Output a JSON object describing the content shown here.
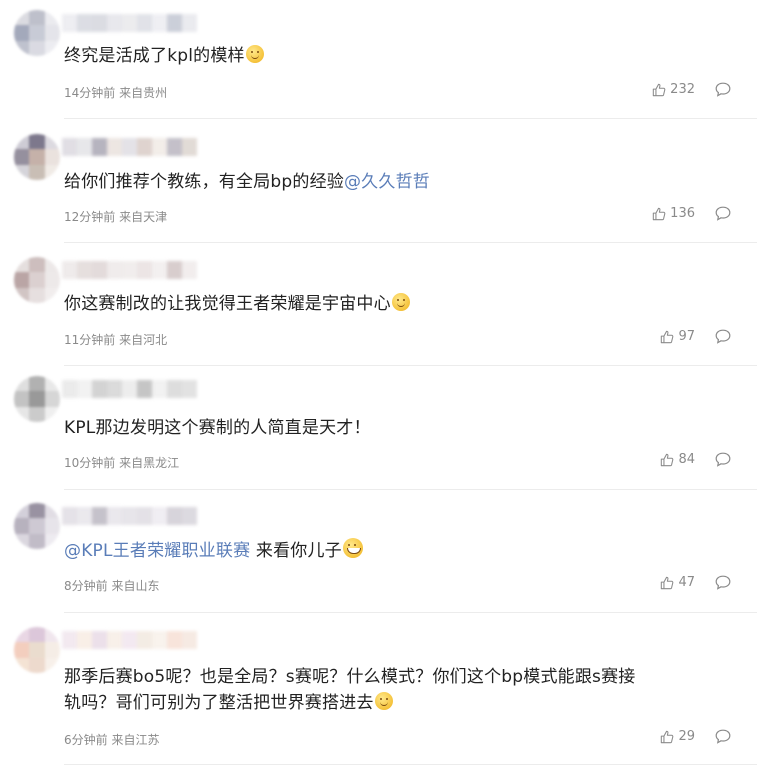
{
  "comments": [
    {
      "text_parts": [
        "终究是活成了kpl的模样"
      ],
      "mention": "",
      "after_mention": "",
      "emoji": "smile-emoji",
      "time": "14分钟前",
      "location": "来自贵州",
      "likes": "232",
      "avatar_colors": [
        "#d8d8de",
        "#b8bac6",
        "#e9e9ee",
        "#9aa0b4",
        "#c3c6d2",
        "#e2e2e8",
        "#b9bcc9",
        "#d6d7df",
        "#ebebf0"
      ]
    },
    {
      "text_parts": [
        "给你们推荐个教练，有全局bp的经验"
      ],
      "mention": "@久久哲哲",
      "after_mention": "",
      "emoji": "",
      "time": "12分钟前",
      "location": "来自天津",
      "likes": "136",
      "avatar_colors": [
        "#c9c7d1",
        "#6f6a80",
        "#d9d6dd",
        "#8a8494",
        "#bfa9a0",
        "#e8dfdb",
        "#d1d0d6",
        "#c4b8ae",
        "#efe9e4"
      ]
    },
    {
      "text_parts": [
        "你这赛制改的让我觉得王者荣耀是宇宙中心"
      ],
      "mention": "",
      "after_mention": "",
      "emoji": "smile-emoji",
      "time": "11分钟前",
      "location": "来自河北",
      "likes": "97",
      "avatar_colors": [
        "#e3dcdb",
        "#c8b8b7",
        "#ebe6e6",
        "#b39c9c",
        "#d8cccc",
        "#ece7e7",
        "#cdbfbe",
        "#e4dcdc",
        "#f0ecec"
      ]
    },
    {
      "text_parts": [
        "KPL那边发明这个赛制的人简直是天才！"
      ],
      "mention": "",
      "after_mention": "",
      "emoji": "",
      "time": "10分钟前",
      "location": "来自黑龙江",
      "likes": "84",
      "avatar_colors": [
        "#dcdcdc",
        "#a9a9a9",
        "#e6e6e6",
        "#bdbdbd",
        "#8e8e8e",
        "#d2d2d2",
        "#e4e4e4",
        "#c6c6c6",
        "#eeeeee"
      ]
    },
    {
      "text_parts": [
        ""
      ],
      "mention": "@KPL王者荣耀职业联赛",
      "after_mention": " 来看你儿子",
      "emoji": "grin-emoji",
      "time": "8分钟前",
      "location": "来自山东",
      "likes": "47",
      "avatar_colors": [
        "#cfcbd6",
        "#8e8798",
        "#dedae2",
        "#b0aab8",
        "#c9c4cf",
        "#e5e2e8",
        "#d7d3dc",
        "#bbb5c2",
        "#ece9ef"
      ]
    },
    {
      "text_parts": [
        "那季后赛bo5呢？也是全局？s赛呢？什么模式？你们这个bp模式能跟s赛接",
        "轨吗？哥们可别为了整活把世界赛搭进去"
      ],
      "mention": "",
      "after_mention": "",
      "emoji": "smile-emoji",
      "time": "6分钟前",
      "location": "来自江苏",
      "likes": "29",
      "avatar_colors": [
        "#e7d3e2",
        "#d9c2d6",
        "#efe4ec",
        "#f2c9b8",
        "#e8d9c9",
        "#f5ece4",
        "#f3e0d0",
        "#ecd6c8",
        "#f7efe8"
      ]
    }
  ]
}
